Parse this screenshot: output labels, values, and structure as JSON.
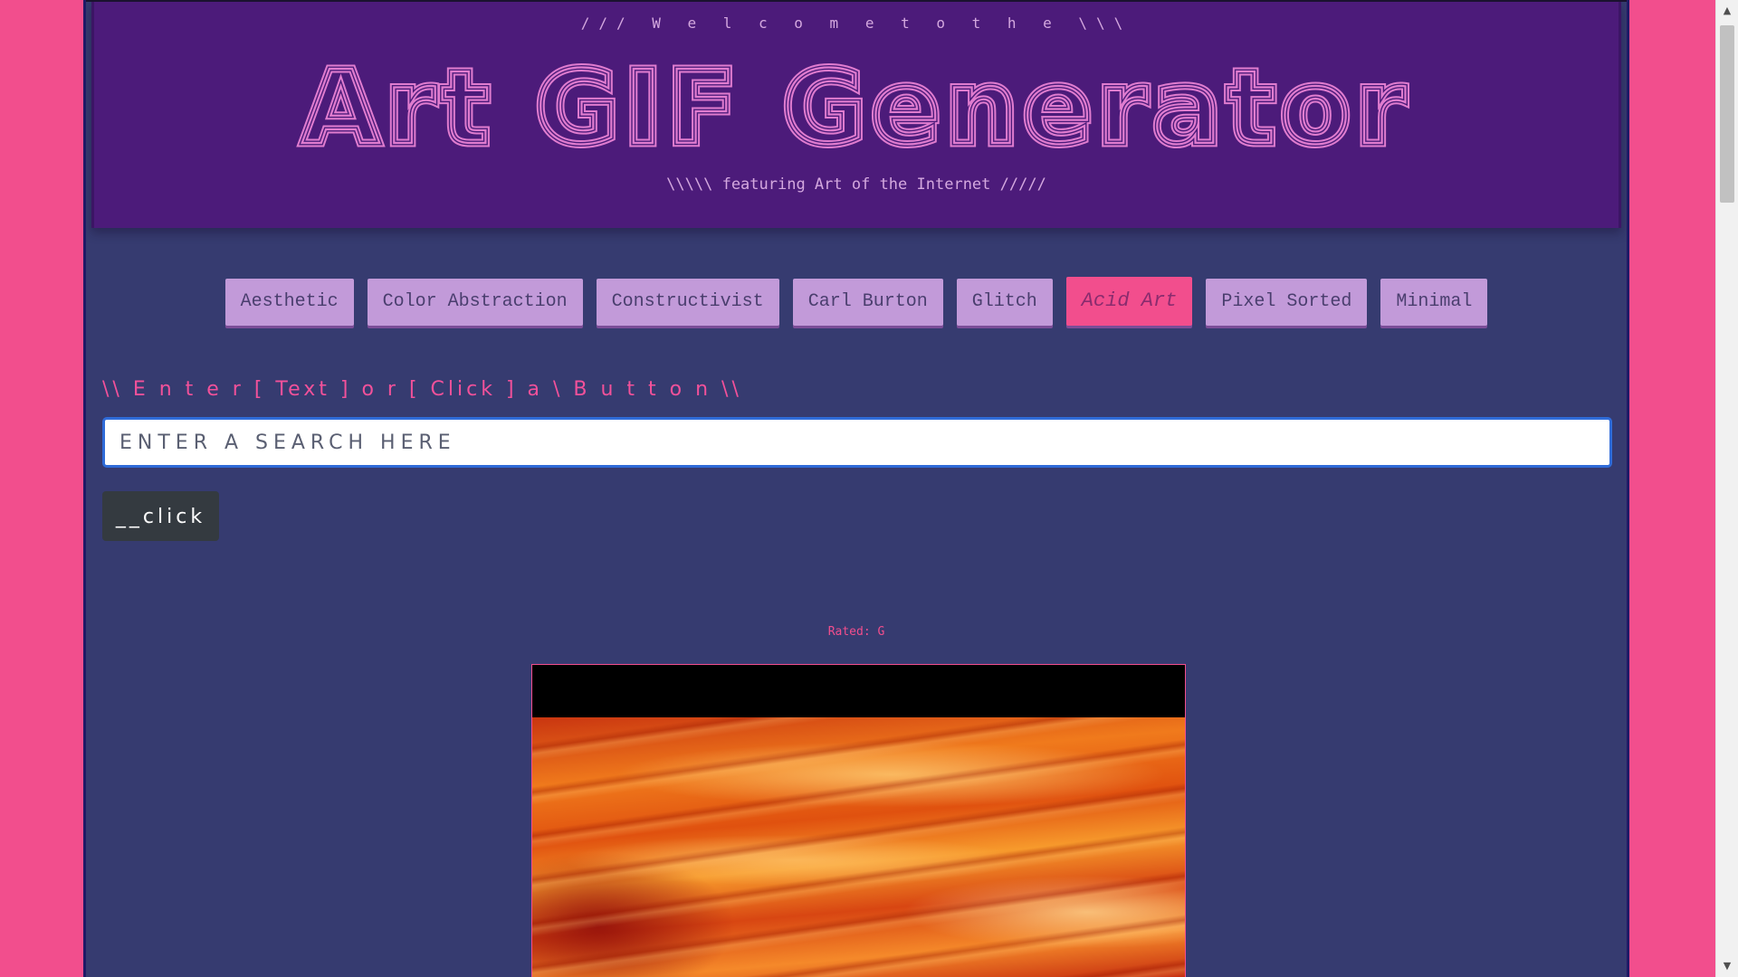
{
  "header": {
    "welcome": "/// W e l c o m e t o t h e \\\\\\",
    "title": "Art GIF Generator",
    "subtitle": "\\\\\\\\\\ featuring Art of the Internet /////"
  },
  "categories": [
    {
      "label": "Aesthetic",
      "active": false
    },
    {
      "label": "Color Abstraction",
      "active": false
    },
    {
      "label": "Constructivist",
      "active": false
    },
    {
      "label": "Carl Burton",
      "active": false
    },
    {
      "label": "Glitch",
      "active": false
    },
    {
      "label": "Acid Art",
      "active": true
    },
    {
      "label": "Pixel Sorted",
      "active": false
    },
    {
      "label": "Minimal",
      "active": false
    }
  ],
  "search": {
    "prompt": "\\\\ E n t e r [ Text ] o r [ Click ] a \\ B u t t o n \\\\",
    "placeholder": "ENTER A SEARCH HERE",
    "value": "",
    "button_label": "__click"
  },
  "result": {
    "rating": "Rated: G"
  },
  "colors": {
    "background": "#f24e8d",
    "page": "#363b70",
    "header": "#4c1b7a",
    "title_stroke": "#e07ccf",
    "button": "#c29ad9",
    "active_button": "#f24e8d",
    "accent_text": "#f2519a"
  },
  "icons": {
    "scroll_up": "chevron-up-icon",
    "scroll_down": "chevron-down-icon"
  }
}
